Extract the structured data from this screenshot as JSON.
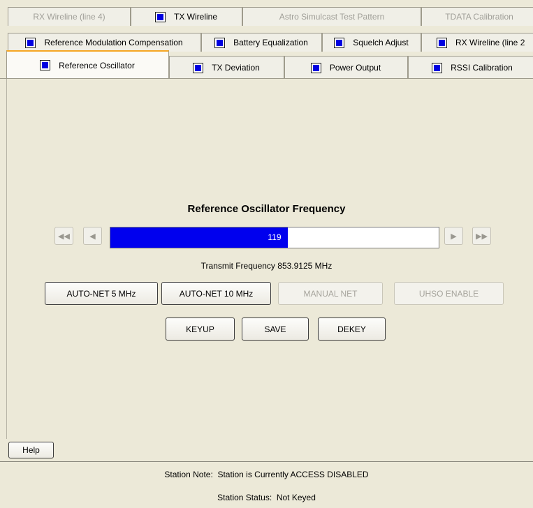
{
  "tabs": {
    "row1": [
      {
        "label": "RX Wireline (line 4)",
        "enabled": false,
        "icon": false
      },
      {
        "label": "TX Wireline",
        "enabled": true,
        "icon": true
      },
      {
        "label": "Astro Simulcast Test Pattern",
        "enabled": false,
        "icon": false
      },
      {
        "label": "TDATA Calibration",
        "enabled": false,
        "icon": false
      }
    ],
    "row2": [
      {
        "label": "Reference Modulation Compensation",
        "enabled": true,
        "icon": true
      },
      {
        "label": "Battery Equalization",
        "enabled": true,
        "icon": true
      },
      {
        "label": "Squelch Adjust",
        "enabled": true,
        "icon": true
      },
      {
        "label": "RX Wireline (line 2",
        "enabled": true,
        "icon": true
      }
    ],
    "row3": [
      {
        "label": "Reference Oscillator",
        "enabled": true,
        "icon": true,
        "active": true
      },
      {
        "label": "TX Deviation",
        "enabled": true,
        "icon": true
      },
      {
        "label": "Power Output",
        "enabled": true,
        "icon": true
      },
      {
        "label": "RSSI Calibration",
        "enabled": true,
        "icon": true
      }
    ],
    "tab_icon_color": "#0000e0",
    "active_accent_color": "#f5a623"
  },
  "main": {
    "title": "Reference Oscillator Frequency",
    "slider": {
      "value": "119",
      "fill_fraction": 0.54,
      "fill_color": "#0000ee"
    },
    "transmit_frequency": {
      "label": "Transmit Frequency",
      "value": "853.9125 MHz"
    },
    "buttons_row1": [
      {
        "label": "AUTO-NET 5 MHz",
        "enabled": true
      },
      {
        "label": "AUTO-NET 10 MHz",
        "enabled": true
      },
      {
        "label": "MANUAL NET",
        "enabled": false
      },
      {
        "label": "UHSO ENABLE",
        "enabled": false
      }
    ],
    "buttons_row2": [
      {
        "label": "KEYUP",
        "enabled": true
      },
      {
        "label": "SAVE",
        "enabled": true
      },
      {
        "label": "DEKEY",
        "enabled": true
      }
    ]
  },
  "help_label": "Help",
  "status": {
    "note_label": "Station Note:",
    "note_value": "Station is Currently ACCESS DISABLED",
    "status_label": "Station Status:",
    "status_value": "Not Keyed"
  }
}
